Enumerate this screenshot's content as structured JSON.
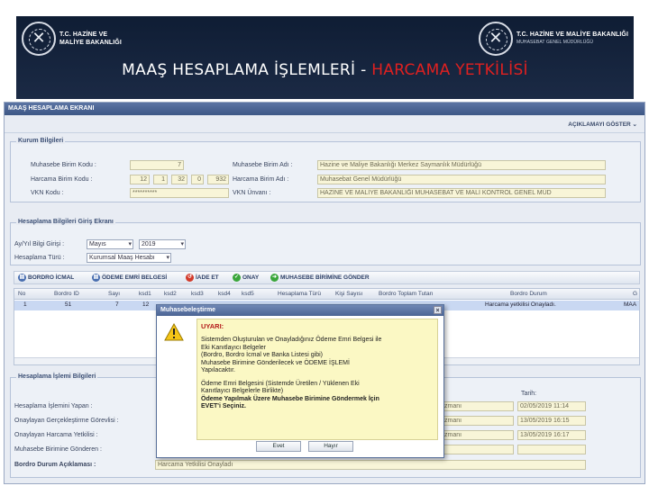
{
  "banner": {
    "logo_left": [
      "T.C. HAZİNE VE",
      "MALİYE BAKANLIĞI"
    ],
    "logo_right": "T.C. HAZİNE VE MALİYE BAKANLIĞI",
    "logo_right_sub": "MUHASEBAT GENEL MÜDÜRLÜĞÜ",
    "title_main": "MAAŞ HESAPLAMA İŞLEMLERİ -",
    "title_accent": "HARCAMA YETKİLİSİ"
  },
  "app": {
    "header": "MAAŞ HESAPLAMA EKRANI",
    "toggle_label": "AÇIKLAMAYI GÖSTER",
    "kurum": {
      "title": "Kurum Bilgileri",
      "muhasebe_birim_kodu_label": "Muhasebe Birim Kodu :",
      "muhasebe_birim_kodu": "7",
      "harcama_birim_kodu_label": "Harcama Birim Kodu :",
      "harcama_parts": [
        "12",
        "1",
        "32",
        "0",
        "932"
      ],
      "vkn_kodu_label": "VKN Kodu :",
      "vkn_kodu": "**********",
      "muhasebe_birim_adi_label": "Muhasebe Birim Adı :",
      "muhasebe_birim_adi": "Hazine ve Maliye Bakanlığı Merkez Saymanlık Müdürlüğü",
      "harcama_birim_adi_label": "Harcama Birim Adı :",
      "harcama_birim_adi": "Muhasebat Genel Müdürlüğü",
      "vkn_unvani_label": "VKN Ünvanı :",
      "vkn_unvani": "HAZİNE VE MALİYE BAKANLIĞI MUHASEBAT VE MALİ KONTROL GENEL MÜD"
    },
    "hesaplama": {
      "title": "Hesaplama Bilgileri Giriş Ekranı",
      "ay_yil_label": "Ay/Yıl Bilgi Girişi :",
      "ay": "Mayıs",
      "yil": "2019",
      "turu_label": "Hesaplama Türü :",
      "turu": "Kurumsal Maaş Hesabı"
    },
    "toolbar": {
      "bordro_icmal": "BORDRO İCMAL",
      "odeme_emri": "ÖDEME EMRİ BELGESİ",
      "iade_et": "İADE ET",
      "onay": "ONAY",
      "muhasebe_gonder": "MUHASEBE BİRİMİNE GÖNDER"
    },
    "grid": {
      "columns": [
        "No",
        "Bordro ID",
        "Sayı",
        "ksd1",
        "ksd2",
        "ksd3",
        "ksd4",
        "ksd5",
        "Hesaplama Türü",
        "Kişi Sayısı",
        "Bordro Toplam Tutarı",
        "Bordro Durum",
        "G"
      ],
      "row": {
        "no": "1",
        "bordro_id": "51",
        "sayi": "7",
        "ksd1": "12",
        "durum": "Harcama yetkilisi Onayladı.",
        "last": "MAA"
      }
    },
    "islem": {
      "title": "Hesaplama İşlemi Bilgileri",
      "tarih_label": "Tarih:",
      "rows": [
        {
          "label": "Hesaplama İşlemini Yapan :",
          "name": "zmanı",
          "date": "02/05/2019 11:14"
        },
        {
          "label": "Onaylayan Gerçekleştirme Görevlisi :",
          "name": "zmanı",
          "date": "13/05/2019 16:15"
        },
        {
          "label": "Onaylayan Harcama Yetkilisi :",
          "name": "zmanı",
          "date": "13/05/2019 16:17"
        },
        {
          "label": "Muhasebe Birimine Gönderen :",
          "name": "",
          "date": ""
        }
      ],
      "bordro_durum_label": "Bordro Durum Açıklaması :",
      "bordro_durum": "Harcama Yetkilisi Onayladı"
    }
  },
  "dialog": {
    "title": "Muhasebeleştirme",
    "warning_title": "UYARI:",
    "lines1": [
      "Sistemden Oluşturulan ve Onayladığınız Ödeme Emri Belgesi ile",
      "Eki Kanıtlayıcı Belgeler",
      "(Bordro, Bordro İcmal ve Banka Listesi gibi)",
      "Muhasebe Birimine Gönderilecek ve ÖDEME İŞLEMİ",
      "Yapılacaktır."
    ],
    "lines2": [
      "Ödeme Emri Belgesini (Sistemde Üretilen / Yüklenen Eki",
      "Kanıtlayıcı Belgelerle Birlikte)",
      "Ödeme Yapılmak Üzere Muhasebe Birimine Göndermek İçin",
      "EVET'i Seçiniz."
    ],
    "yes_label": "Evet",
    "no_label": "Hayır"
  },
  "colors": {
    "banner_bg": "#0f1d34",
    "accent_red": "#e02020",
    "header_blue": "#3d5785",
    "warning_bg": "#fbf8c4"
  }
}
